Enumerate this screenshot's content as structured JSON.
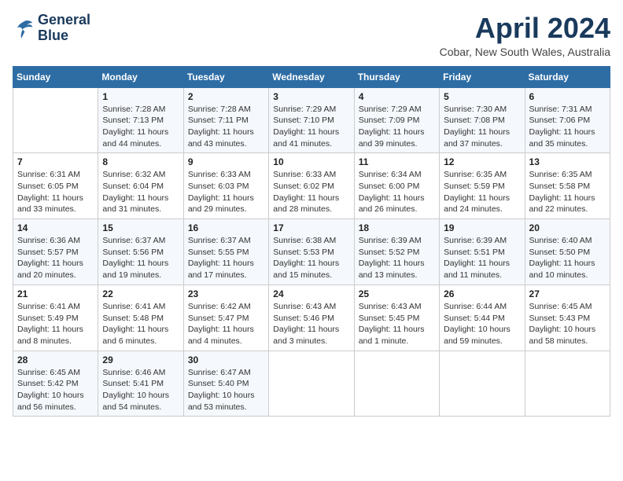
{
  "header": {
    "logo_line1": "General",
    "logo_line2": "Blue",
    "month": "April 2024",
    "location": "Cobar, New South Wales, Australia"
  },
  "days_of_week": [
    "Sunday",
    "Monday",
    "Tuesday",
    "Wednesday",
    "Thursday",
    "Friday",
    "Saturday"
  ],
  "weeks": [
    [
      {
        "day": "",
        "info": ""
      },
      {
        "day": "1",
        "info": "Sunrise: 7:28 AM\nSunset: 7:13 PM\nDaylight: 11 hours\nand 44 minutes."
      },
      {
        "day": "2",
        "info": "Sunrise: 7:28 AM\nSunset: 7:11 PM\nDaylight: 11 hours\nand 43 minutes."
      },
      {
        "day": "3",
        "info": "Sunrise: 7:29 AM\nSunset: 7:10 PM\nDaylight: 11 hours\nand 41 minutes."
      },
      {
        "day": "4",
        "info": "Sunrise: 7:29 AM\nSunset: 7:09 PM\nDaylight: 11 hours\nand 39 minutes."
      },
      {
        "day": "5",
        "info": "Sunrise: 7:30 AM\nSunset: 7:08 PM\nDaylight: 11 hours\nand 37 minutes."
      },
      {
        "day": "6",
        "info": "Sunrise: 7:31 AM\nSunset: 7:06 PM\nDaylight: 11 hours\nand 35 minutes."
      }
    ],
    [
      {
        "day": "7",
        "info": "Sunrise: 6:31 AM\nSunset: 6:05 PM\nDaylight: 11 hours\nand 33 minutes."
      },
      {
        "day": "8",
        "info": "Sunrise: 6:32 AM\nSunset: 6:04 PM\nDaylight: 11 hours\nand 31 minutes."
      },
      {
        "day": "9",
        "info": "Sunrise: 6:33 AM\nSunset: 6:03 PM\nDaylight: 11 hours\nand 29 minutes."
      },
      {
        "day": "10",
        "info": "Sunrise: 6:33 AM\nSunset: 6:02 PM\nDaylight: 11 hours\nand 28 minutes."
      },
      {
        "day": "11",
        "info": "Sunrise: 6:34 AM\nSunset: 6:00 PM\nDaylight: 11 hours\nand 26 minutes."
      },
      {
        "day": "12",
        "info": "Sunrise: 6:35 AM\nSunset: 5:59 PM\nDaylight: 11 hours\nand 24 minutes."
      },
      {
        "day": "13",
        "info": "Sunrise: 6:35 AM\nSunset: 5:58 PM\nDaylight: 11 hours\nand 22 minutes."
      }
    ],
    [
      {
        "day": "14",
        "info": "Sunrise: 6:36 AM\nSunset: 5:57 PM\nDaylight: 11 hours\nand 20 minutes."
      },
      {
        "day": "15",
        "info": "Sunrise: 6:37 AM\nSunset: 5:56 PM\nDaylight: 11 hours\nand 19 minutes."
      },
      {
        "day": "16",
        "info": "Sunrise: 6:37 AM\nSunset: 5:55 PM\nDaylight: 11 hours\nand 17 minutes."
      },
      {
        "day": "17",
        "info": "Sunrise: 6:38 AM\nSunset: 5:53 PM\nDaylight: 11 hours\nand 15 minutes."
      },
      {
        "day": "18",
        "info": "Sunrise: 6:39 AM\nSunset: 5:52 PM\nDaylight: 11 hours\nand 13 minutes."
      },
      {
        "day": "19",
        "info": "Sunrise: 6:39 AM\nSunset: 5:51 PM\nDaylight: 11 hours\nand 11 minutes."
      },
      {
        "day": "20",
        "info": "Sunrise: 6:40 AM\nSunset: 5:50 PM\nDaylight: 11 hours\nand 10 minutes."
      }
    ],
    [
      {
        "day": "21",
        "info": "Sunrise: 6:41 AM\nSunset: 5:49 PM\nDaylight: 11 hours\nand 8 minutes."
      },
      {
        "day": "22",
        "info": "Sunrise: 6:41 AM\nSunset: 5:48 PM\nDaylight: 11 hours\nand 6 minutes."
      },
      {
        "day": "23",
        "info": "Sunrise: 6:42 AM\nSunset: 5:47 PM\nDaylight: 11 hours\nand 4 minutes."
      },
      {
        "day": "24",
        "info": "Sunrise: 6:43 AM\nSunset: 5:46 PM\nDaylight: 11 hours\nand 3 minutes."
      },
      {
        "day": "25",
        "info": "Sunrise: 6:43 AM\nSunset: 5:45 PM\nDaylight: 11 hours\nand 1 minute."
      },
      {
        "day": "26",
        "info": "Sunrise: 6:44 AM\nSunset: 5:44 PM\nDaylight: 10 hours\nand 59 minutes."
      },
      {
        "day": "27",
        "info": "Sunrise: 6:45 AM\nSunset: 5:43 PM\nDaylight: 10 hours\nand 58 minutes."
      }
    ],
    [
      {
        "day": "28",
        "info": "Sunrise: 6:45 AM\nSunset: 5:42 PM\nDaylight: 10 hours\nand 56 minutes."
      },
      {
        "day": "29",
        "info": "Sunrise: 6:46 AM\nSunset: 5:41 PM\nDaylight: 10 hours\nand 54 minutes."
      },
      {
        "day": "30",
        "info": "Sunrise: 6:47 AM\nSunset: 5:40 PM\nDaylight: 10 hours\nand 53 minutes."
      },
      {
        "day": "",
        "info": ""
      },
      {
        "day": "",
        "info": ""
      },
      {
        "day": "",
        "info": ""
      },
      {
        "day": "",
        "info": ""
      }
    ]
  ]
}
